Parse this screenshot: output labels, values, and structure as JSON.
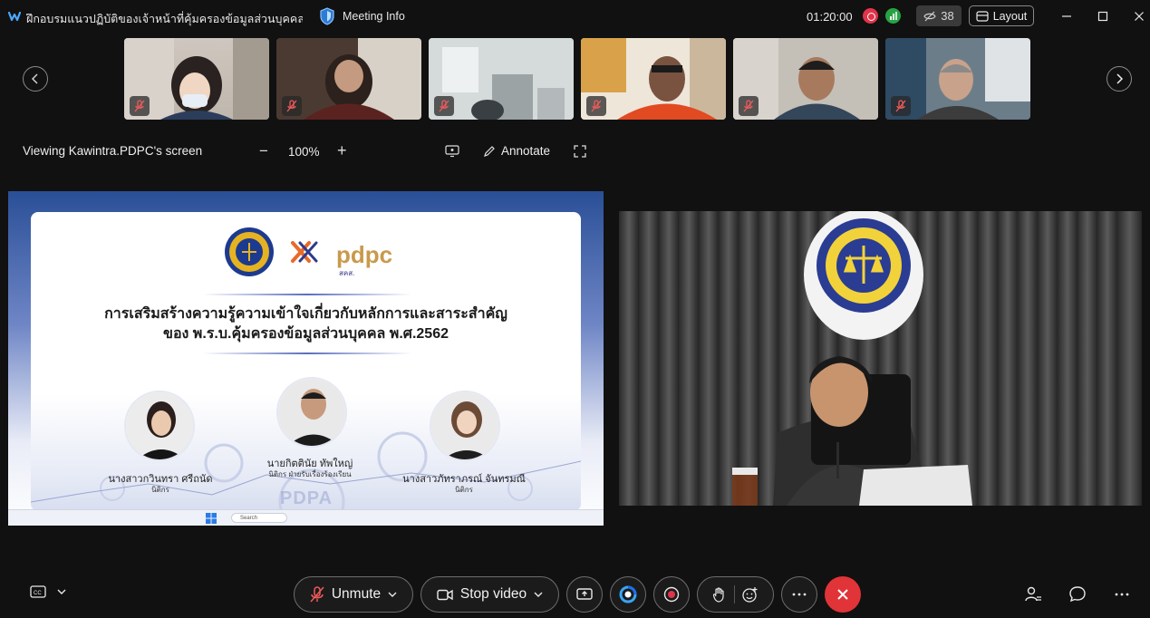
{
  "window": {
    "title": "ฝึกอบรมแนวปฏิบัติของเจ้าหน้าที่คุ้มครองข้อมูลส่วนบุคคล (D...",
    "meeting_info_label": "Meeting Info",
    "timer": "01:20:00",
    "participant_count": "38",
    "layout_label": "Layout"
  },
  "thumbnails": [
    {
      "id": "participant-1",
      "muted": true
    },
    {
      "id": "participant-2",
      "muted": true
    },
    {
      "id": "participant-3",
      "muted": true
    },
    {
      "id": "participant-4",
      "muted": true
    },
    {
      "id": "participant-5",
      "muted": true
    },
    {
      "id": "participant-6",
      "muted": true
    }
  ],
  "share_bar": {
    "viewing_label": "Viewing Kawintra.PDPC's screen",
    "zoom": "100%",
    "annotate_label": "Annotate"
  },
  "slide": {
    "headline_line1": "การเสริมสร้างความรู้ความเข้าใจเกี่ยวกับหลักการและสาระสำคัญ",
    "headline_line2": "ของ พ.ร.บ.คุ้มครองข้อมูลส่วนบุคคล พ.ศ.2562",
    "logo_text": "pdpc",
    "logo_sub": "สคส.",
    "speakers": [
      {
        "name": "นางสาวกวินทรา ศรีถนัด",
        "role": "นิติกร"
      },
      {
        "name": "นายกิตตินัย ทัพใหญ่",
        "role": "นิติกร ฝ่ายรับเรื่องร้องเรียน"
      },
      {
        "name": "นางสาวภัทราภรณ์ จันทรมณี",
        "role": "นิติกร"
      }
    ],
    "watermark": "PDPA",
    "taskbar_search": "Search"
  },
  "toolbar": {
    "unmute_label": "Unmute",
    "stop_video_label": "Stop video"
  },
  "colors": {
    "background": "#111111",
    "end_call": "#e13438",
    "record": "#e0344a",
    "signal": "#27a343"
  },
  "icons": [
    "webex-logo-icon",
    "shield-icon",
    "record-icon",
    "signal-icon",
    "hidden-eye-icon",
    "layout-icon",
    "minimize-icon",
    "maximize-icon",
    "close-icon",
    "chevron-left-icon",
    "chevron-right-icon",
    "mic-off-icon",
    "share-screen-icon",
    "annotate-icon",
    "fullscreen-icon",
    "cc-icon",
    "chevron-down-icon",
    "camera-icon",
    "share-icon",
    "ai-assistant-icon",
    "record-button-icon",
    "raise-hand-icon",
    "reactions-icon",
    "more-icon",
    "end-call-icon",
    "participants-icon",
    "chat-icon"
  ]
}
